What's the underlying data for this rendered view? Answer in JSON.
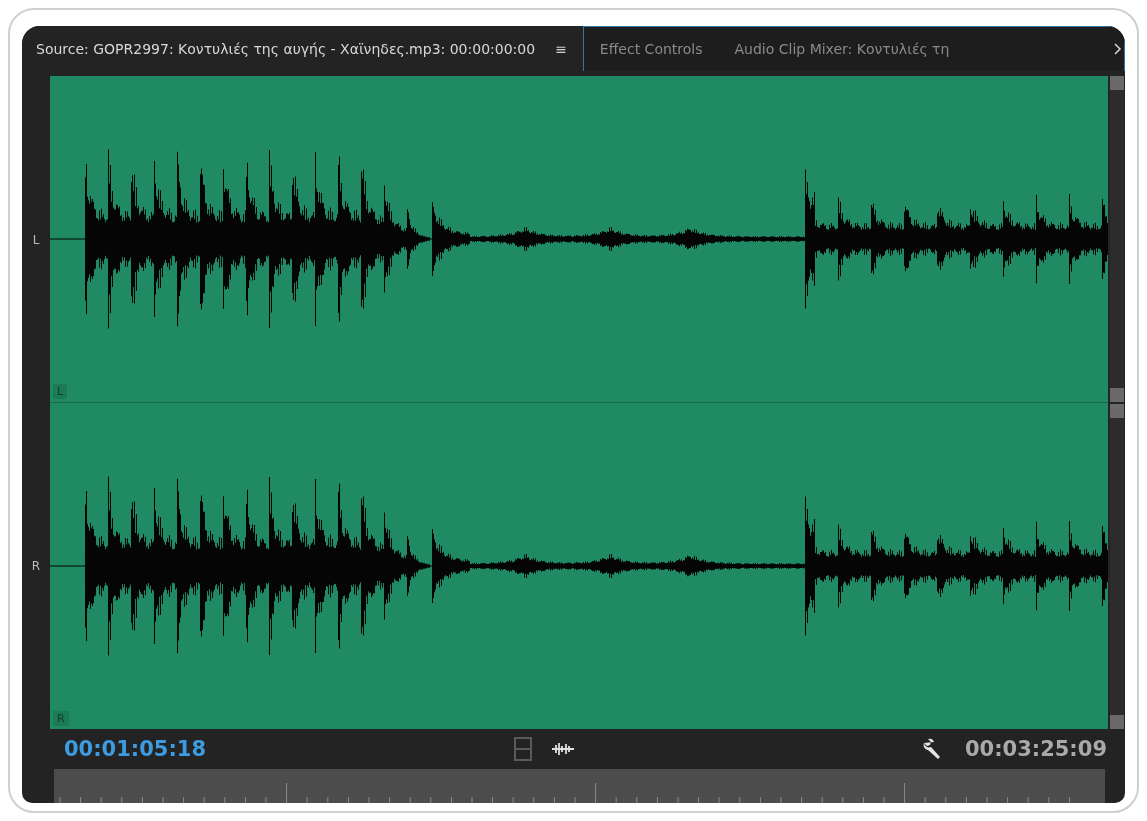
{
  "tabs": [
    {
      "label": "Source: GOPR2997: Κοντυλιές της αυγής - Χαϊνηδες.mp3: 00:00:00:00",
      "selected": true,
      "menu": "≡"
    },
    {
      "label": "Effect Controls",
      "selected": false
    },
    {
      "label": "Audio Clip Mixer: Κοντυλιές τη",
      "selected": false
    }
  ],
  "channels": [
    {
      "label": "L",
      "corner": "L"
    },
    {
      "label": "R",
      "corner": "R"
    }
  ],
  "footer": {
    "current_time": "00:01:05:18",
    "duration": "00:03:25:09"
  }
}
